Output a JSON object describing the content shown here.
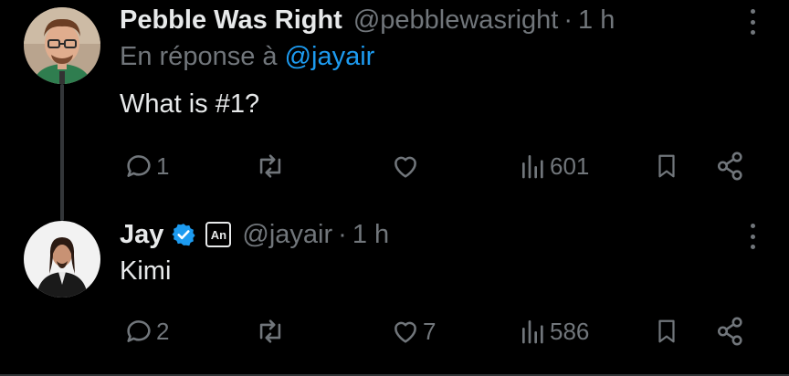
{
  "tweets": [
    {
      "display_name": "Pebble Was Right",
      "handle": "@pebblewasright",
      "separator": "·",
      "time": "1 h",
      "reply_prefix": "En réponse à",
      "reply_mention": "@jayair",
      "text": "What is #1?",
      "replies": "1",
      "reposts": "",
      "likes": "",
      "views": "601",
      "avatar_icon": "avatar-man-glasses"
    },
    {
      "display_name": "Jay",
      "verified_icon": "verified-badge-icon",
      "badge_label": "An",
      "handle": "@jayair",
      "separator": "·",
      "time": "1 h",
      "text": "Kimi",
      "replies": "2",
      "reposts": "",
      "likes": "7",
      "views": "586",
      "avatar_icon": "avatar-man-long-hair"
    }
  ],
  "colors": {
    "background": "#000000",
    "primary_text": "#e7e9ea",
    "secondary_text": "#71767b",
    "accent": "#1d9bf0",
    "thread_line": "#333639"
  }
}
